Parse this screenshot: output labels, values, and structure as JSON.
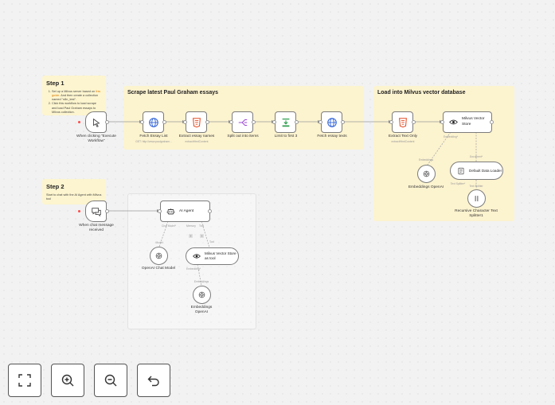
{
  "sticky_step1": {
    "heading": "Step 1",
    "line1": "Set up a Milvus server based on ",
    "link": "this guide",
    "line1b": ". And then create a collection named \"n8n_test\".",
    "line2": "Click this workflow to load scrape and load Paul Graham essays to Milvus collection."
  },
  "sticky_step2": {
    "heading": "Step 2",
    "text": "Start to chat with the AI Agent with Milvus tool"
  },
  "sections": {
    "scrape_title": "Scrape latest Paul Graham essays",
    "load_title": "Load into Milvus vector database"
  },
  "nodes": {
    "manual_trigger": "When clicking \"Execute Workflow\"",
    "fetch_list": "Fetch Essay List",
    "fetch_list_sub": "GET: http://www.paulgraham...",
    "extract_names": "Extract essay names",
    "extract_names_sub": "extractHtmlContent",
    "split_out": "Split out into items",
    "limit": "Limit to first 3",
    "fetch_texts": "Fetch essay texts",
    "extract_text": "Extract Text Only",
    "extract_text_sub": "extractHtmlContent",
    "milvus_store": "Milvus Vector Store",
    "embeddings_openai_1": "Embeddings OpenAI",
    "data_loader": "Default Data Loader",
    "text_splitter": "Recursive Character Text Splitter1",
    "chat_trigger": "When chat message received",
    "ai_agent": "AI Agent",
    "openai_chat": "OpenAI Chat Model",
    "milvus_tool": "Milvus Vector Store as tool",
    "embeddings_openai_2": "Embeddings OpenAI"
  },
  "ports": {
    "embedding_req": "Embedding*",
    "document": "Document*",
    "embeddings": "Embeddings",
    "document2": "Document",
    "text_splitter": "Text Splitter*",
    "text_splitter2": "Text Splitter",
    "chat_model_req": "Chat Model*",
    "memory": "Memory",
    "tool": "Tool",
    "model": "Model",
    "tool2": "Tool",
    "embedding_req2": "Embedding*",
    "embeddings2": "Embeddings"
  },
  "controls": {
    "fit": "fit-view",
    "zoom_in": "zoom-in",
    "zoom_out": "zoom-out",
    "undo": "undo"
  },
  "colors": {
    "sticky": "#fdf5cf",
    "html_icon": "#e44d26",
    "globe_icon": "#2c5fd6",
    "split_icon": "#9b4dd6",
    "limit_icon": "#2e9e4f",
    "trigger_dot": "#ff4b4b"
  }
}
